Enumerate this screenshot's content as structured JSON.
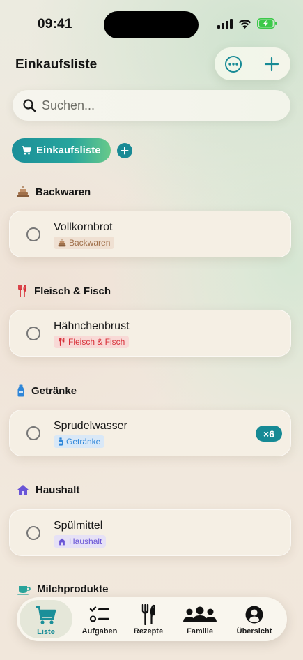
{
  "status_bar": {
    "time": "09:41"
  },
  "header": {
    "title": "Einkaufsliste"
  },
  "search": {
    "placeholder": "Suchen..."
  },
  "lists": {
    "active_label": "Einkaufsliste"
  },
  "sections": [
    {
      "title": "Backwaren",
      "item": {
        "name": "Vollkornbrot",
        "tag": "Backwaren"
      }
    },
    {
      "title": "Fleisch & Fisch",
      "item": {
        "name": "Hähnchenbrust",
        "tag": "Fleisch & Fisch"
      }
    },
    {
      "title": "Getränke",
      "item": {
        "name": "Sprudelwasser",
        "tag": "Getränke",
        "quantity": "×6"
      }
    },
    {
      "title": "Haushalt",
      "item": {
        "name": "Spülmittel",
        "tag": "Haushalt"
      }
    },
    {
      "title": "Milchprodukte"
    }
  ],
  "tab_bar": {
    "tabs": [
      {
        "label": "Liste",
        "icon": "cart-icon",
        "active": true
      },
      {
        "label": "Aufgaben",
        "icon": "checklist-icon"
      },
      {
        "label": "Rezepte",
        "icon": "fork-knife-icon"
      },
      {
        "label": "Familie",
        "icon": "people-icon"
      },
      {
        "label": "Übersicht",
        "icon": "person-circle-icon"
      }
    ]
  },
  "colors": {
    "accent": "#1b8f99",
    "backwaren": "#a0704a",
    "fleisch": "#d8323a",
    "getraenke": "#2f86d8",
    "haushalt": "#6a55d6",
    "milch": "#2aa39a"
  }
}
